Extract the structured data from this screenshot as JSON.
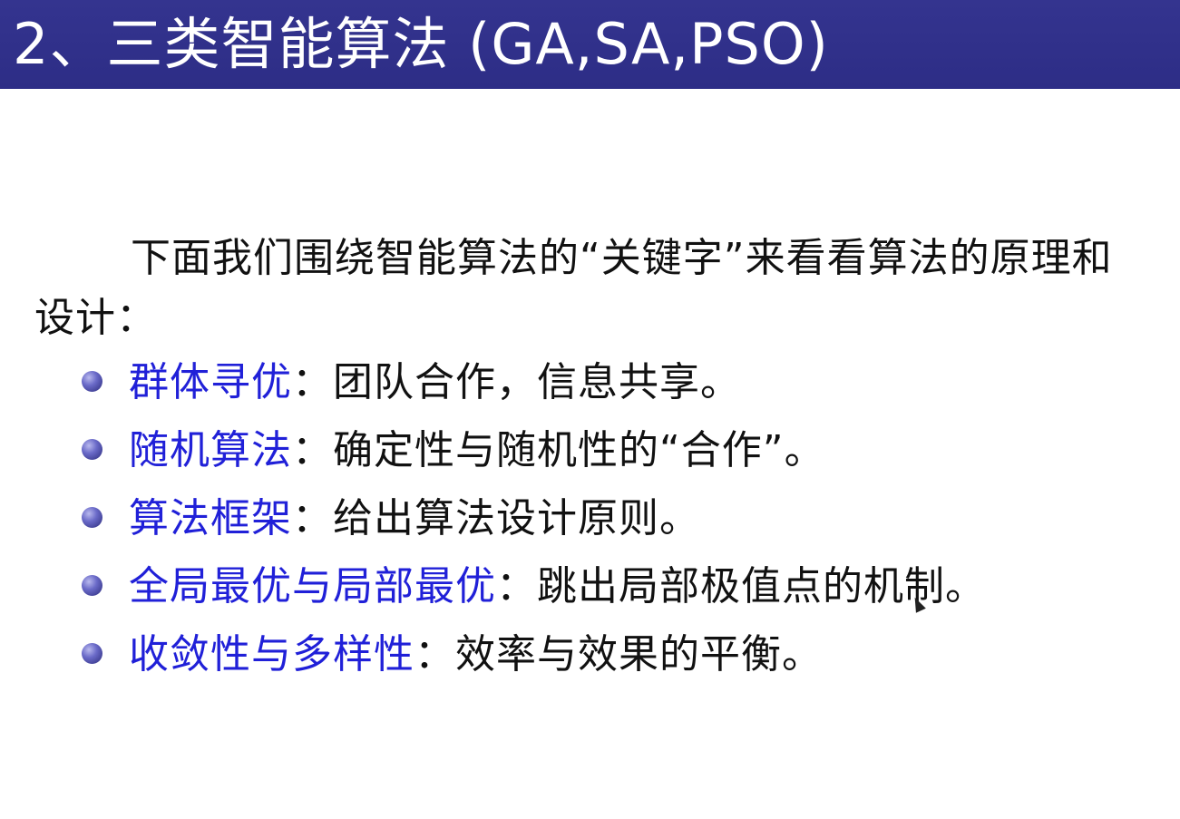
{
  "slide": {
    "title": "2、三类智能算法 (GA,SA,PSO)",
    "intro": "下面我们围绕智能算法的“关键字”来看看算法的原理和设计：",
    "bullets": [
      {
        "term": "群体寻优",
        "sep": "：",
        "desc": "团队合作，信息共享。"
      },
      {
        "term": "随机算法",
        "sep": "：",
        "desc": "确定性与随机性的“合作”。"
      },
      {
        "term": "算法框架",
        "sep": "：",
        "desc": "给出算法设计原则。"
      },
      {
        "term": "全局最优与局部最优",
        "sep": "：",
        "desc": "跳出局部极值点的机制。"
      },
      {
        "term": "收敛性与多样性",
        "sep": "：",
        "desc": "效率与效果的平衡。"
      }
    ]
  },
  "colors": {
    "title_bar": "#2d2d86",
    "term_blue": "#2020d8",
    "text": "#111111"
  },
  "icons": {
    "bullet": "bullet-ball-icon",
    "cursor": "mouse-cursor-icon"
  }
}
